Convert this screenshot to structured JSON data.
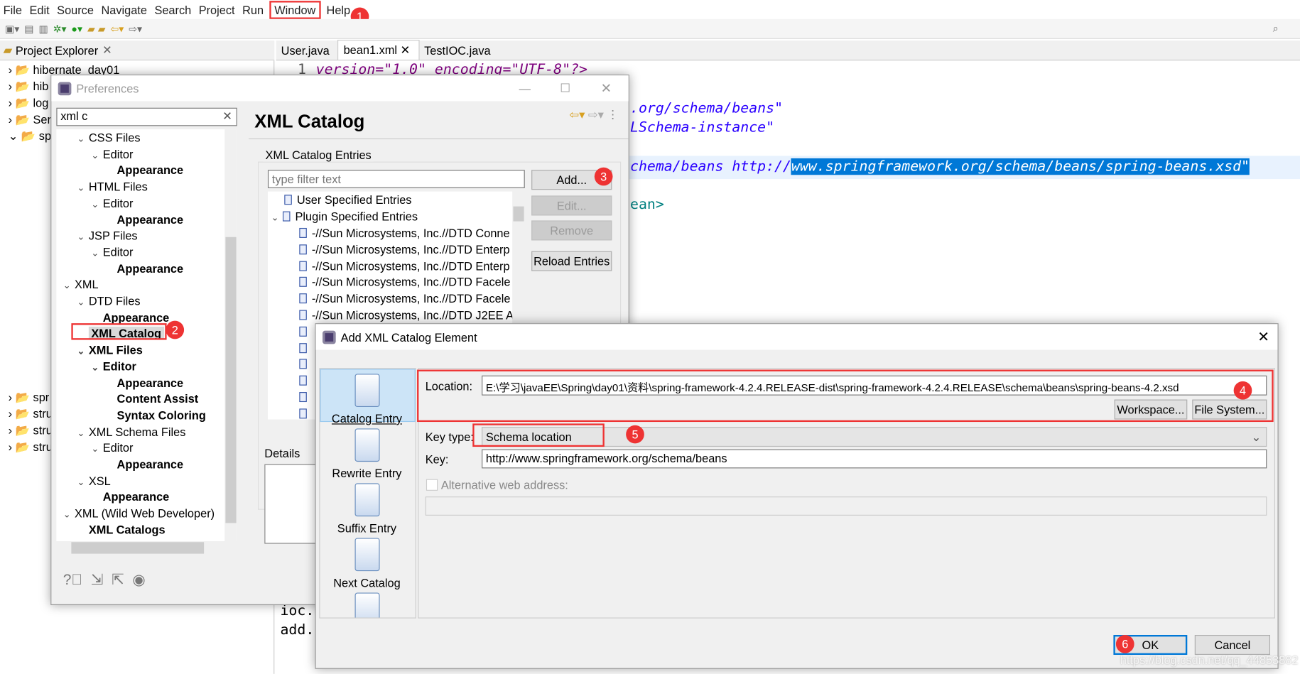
{
  "menu": [
    "File",
    "Edit",
    "Source",
    "Navigate",
    "Search",
    "Project",
    "Run",
    "Window",
    "Help"
  ],
  "project_explorer": {
    "title": "Project Explorer",
    "items": [
      "hibernate_day01",
      "hib",
      "log",
      "Ser",
      "spr",
      "spr",
      "stru",
      "stru",
      "stru"
    ]
  },
  "editor": {
    "tabs": [
      "User.java",
      "bean1.xml",
      "TestIOC.java"
    ],
    "line1_number": "1",
    "line1": "version=\"1.0\" encoding=\"UTF-8\"?>",
    "line_a": ".org/schema/beans\"",
    "line_b": "LSchema-instance\"",
    "line_c_pre": "chema/beans http://",
    "line_c_sel": "www.springframework.org/schema/beans/spring-beans.xsd\"",
    "line_d": "ean>",
    "line_e": "ioc.",
    "line_f": "add."
  },
  "preferences": {
    "title": "Preferences",
    "search_value": "xml c",
    "tree": [
      {
        "label": "CSS Files",
        "level": 1,
        "exp": true,
        "bold": false
      },
      {
        "label": "Editor",
        "level": 2,
        "exp": true,
        "bold": false
      },
      {
        "label": "Appearance",
        "level": 3,
        "bold": true
      },
      {
        "label": "HTML Files",
        "level": 1,
        "exp": true,
        "bold": false
      },
      {
        "label": "Editor",
        "level": 2,
        "exp": true,
        "bold": false
      },
      {
        "label": "Appearance",
        "level": 3,
        "bold": true
      },
      {
        "label": "JSP Files",
        "level": 1,
        "exp": true,
        "bold": false
      },
      {
        "label": "Editor",
        "level": 2,
        "exp": true,
        "bold": false
      },
      {
        "label": "Appearance",
        "level": 3,
        "bold": true
      },
      {
        "label": "XML",
        "level": 0,
        "exp": true,
        "bold": false
      },
      {
        "label": "DTD Files",
        "level": 1,
        "exp": true,
        "bold": false
      },
      {
        "label": "Appearance",
        "level": 2,
        "bold": true
      },
      {
        "label": "XML Catalog",
        "level": 1,
        "bold": true,
        "selected": true
      },
      {
        "label": "XML Files",
        "level": 1,
        "exp": true,
        "bold": true
      },
      {
        "label": "Editor",
        "level": 2,
        "exp": true,
        "bold": true
      },
      {
        "label": "Appearance",
        "level": 3,
        "bold": true
      },
      {
        "label": "Content Assist",
        "level": 3,
        "bold": true
      },
      {
        "label": "Syntax Coloring",
        "level": 3,
        "bold": true
      },
      {
        "label": "XML Schema Files",
        "level": 1,
        "exp": true,
        "bold": false
      },
      {
        "label": "Editor",
        "level": 2,
        "exp": true,
        "bold": false
      },
      {
        "label": "Appearance",
        "level": 3,
        "bold": true
      },
      {
        "label": "XSL",
        "level": 1,
        "exp": true,
        "bold": false
      },
      {
        "label": "Appearance",
        "level": 2,
        "bold": true
      },
      {
        "label": "XML (Wild Web Developer)",
        "level": 0,
        "exp": true,
        "bold": false
      },
      {
        "label": "XML Catalogs",
        "level": 1,
        "bold": true
      }
    ],
    "page_title": "XML Catalog",
    "group_label": "XML Catalog Entries",
    "filter_placeholder": "type filter text",
    "entries": {
      "user": "User Specified Entries",
      "plugin": "Plugin Specified Entries",
      "items": [
        "-//Sun Microsystems, Inc.//DTD Conne",
        "-//Sun Microsystems, Inc.//DTD Enterp",
        "-//Sun Microsystems, Inc.//DTD Enterp",
        "-//Sun Microsystems, Inc.//DTD Facele",
        "-//Sun Microsystems, Inc.//DTD Facele",
        "-//Sun Microsystems, Inc.//DTD J2EE A"
      ]
    },
    "buttons": {
      "add": "Add...",
      "edit": "Edit...",
      "remove": "Remove",
      "reload": "Reload Entries"
    },
    "details_label": "Details"
  },
  "add_dialog": {
    "title": "Add XML Catalog Element",
    "nav": [
      "Catalog Entry",
      "Rewrite Entry",
      "Suffix Entry",
      "Next Catalog"
    ],
    "location_label": "Location:",
    "location_value": "E:\\学习\\javaEE\\Spring\\day01\\资料\\spring-framework-4.2.4.RELEASE-dist\\spring-framework-4.2.4.RELEASE\\schema\\beans\\spring-beans-4.2.xsd",
    "workspace": "Workspace...",
    "file_system": "File System...",
    "key_type_label": "Key type:",
    "key_type_value": "Schema location",
    "key_label": "Key:",
    "key_value": "http://www.springframework.org/schema/beans",
    "alt_label": "Alternative web address:",
    "alt_checked": false,
    "ok": "OK",
    "cancel": "Cancel"
  },
  "badges": [
    "1",
    "2",
    "3",
    "4",
    "5",
    "6"
  ],
  "watermark": "https://blog.csdn.net/qq_44853882",
  "colors": {
    "annotation": "#ee3333",
    "selection": "#0078d7",
    "string": "#2a00ff"
  }
}
